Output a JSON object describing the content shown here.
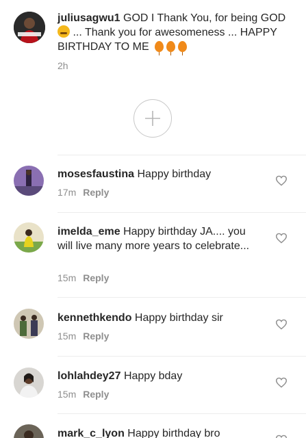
{
  "caption": {
    "username": "juliusagwu1",
    "text_part1": "GOD I Thank You, for being GOD",
    "text_part2": "... Thank you for awesomeness ... HAPPY BIRTHDAY TO ME",
    "time": "2h",
    "emoji_icon": "relieved-face-icon",
    "balloon_icon": "balloon-icon"
  },
  "load_more": {
    "icon": "plus-icon"
  },
  "comments": [
    {
      "username": "mosesfaustina",
      "text": "Happy birthday",
      "time": "17m",
      "reply_label": "Reply"
    },
    {
      "username": "imelda_eme",
      "text": "Happy birthday JA.... you will live many more years to celebrate...",
      "time": "15m",
      "reply_label": "Reply"
    },
    {
      "username": "kennethkendo",
      "text": "Happy birthday sir",
      "time": "15m",
      "reply_label": "Reply"
    },
    {
      "username": "lohlahdey27",
      "text": "Happy bday",
      "time": "15m",
      "reply_label": "Reply"
    },
    {
      "username": "mark_c_lyon",
      "text": "Happy birthday bro",
      "time": "",
      "reply_label": ""
    }
  ],
  "colors": {
    "text": "#262626",
    "secondary": "#8e8e8e",
    "divider": "#ececec",
    "balloon": "#f08a1a"
  }
}
